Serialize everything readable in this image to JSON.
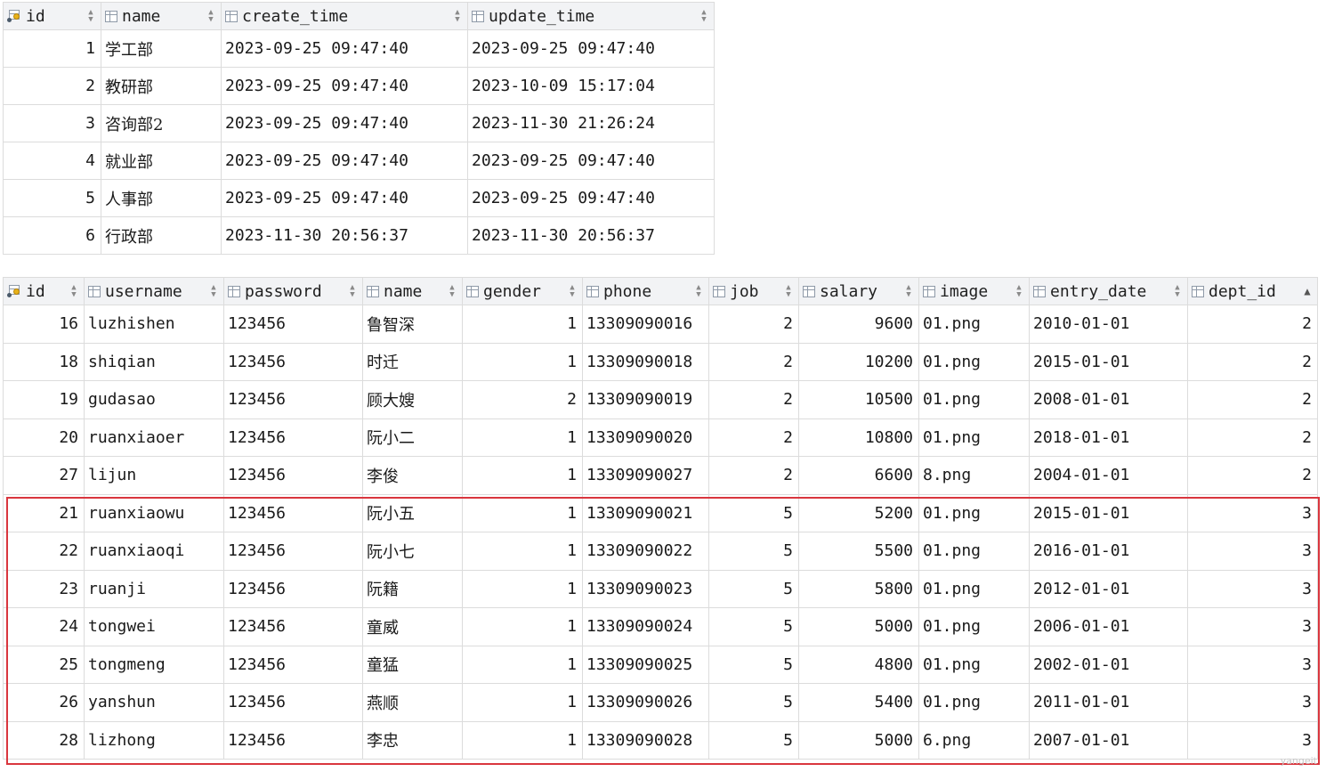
{
  "dept_table": {
    "columns": [
      {
        "key": "id",
        "label": "id",
        "primary": true
      },
      {
        "key": "name",
        "label": "name"
      },
      {
        "key": "create_time",
        "label": "create_time"
      },
      {
        "key": "update_time",
        "label": "update_time"
      }
    ],
    "rows": [
      {
        "id": "1",
        "name": "学工部",
        "create_time": "2023-09-25 09:47:40",
        "update_time": "2023-09-25 09:47:40"
      },
      {
        "id": "2",
        "name": "教研部",
        "create_time": "2023-09-25 09:47:40",
        "update_time": "2023-10-09 15:17:04"
      },
      {
        "id": "3",
        "name": "咨询部2",
        "create_time": "2023-09-25 09:47:40",
        "update_time": "2023-11-30 21:26:24"
      },
      {
        "id": "4",
        "name": "就业部",
        "create_time": "2023-09-25 09:47:40",
        "update_time": "2023-09-25 09:47:40"
      },
      {
        "id": "5",
        "name": "人事部",
        "create_time": "2023-09-25 09:47:40",
        "update_time": "2023-09-25 09:47:40"
      },
      {
        "id": "6",
        "name": "行政部",
        "create_time": "2023-11-30 20:56:37",
        "update_time": "2023-11-30 20:56:37"
      }
    ]
  },
  "emp_table": {
    "columns": [
      {
        "key": "id",
        "label": "id",
        "primary": true
      },
      {
        "key": "username",
        "label": "username"
      },
      {
        "key": "password",
        "label": "password"
      },
      {
        "key": "name",
        "label": "name"
      },
      {
        "key": "gender",
        "label": "gender"
      },
      {
        "key": "phone",
        "label": "phone"
      },
      {
        "key": "job",
        "label": "job"
      },
      {
        "key": "salary",
        "label": "salary"
      },
      {
        "key": "image",
        "label": "image"
      },
      {
        "key": "entry_date",
        "label": "entry_date"
      },
      {
        "key": "dept_id",
        "label": "dept_id",
        "sorted": "asc"
      }
    ],
    "rows": [
      {
        "id": "16",
        "username": "luzhishen",
        "password": "123456",
        "name": "鲁智深",
        "gender": "1",
        "phone": "13309090016",
        "job": "2",
        "salary": "9600",
        "image": "01.png",
        "entry_date": "2010-01-01",
        "dept_id": "2"
      },
      {
        "id": "18",
        "username": "shiqian",
        "password": "123456",
        "name": "时迁",
        "gender": "1",
        "phone": "13309090018",
        "job": "2",
        "salary": "10200",
        "image": "01.png",
        "entry_date": "2015-01-01",
        "dept_id": "2"
      },
      {
        "id": "19",
        "username": "gudasao",
        "password": "123456",
        "name": "顾大嫂",
        "gender": "2",
        "phone": "13309090019",
        "job": "2",
        "salary": "10500",
        "image": "01.png",
        "entry_date": "2008-01-01",
        "dept_id": "2"
      },
      {
        "id": "20",
        "username": "ruanxiaoer",
        "password": "123456",
        "name": "阮小二",
        "gender": "1",
        "phone": "13309090020",
        "job": "2",
        "salary": "10800",
        "image": "01.png",
        "entry_date": "2018-01-01",
        "dept_id": "2"
      },
      {
        "id": "27",
        "username": "lijun",
        "password": "123456",
        "name": "李俊",
        "gender": "1",
        "phone": "13309090027",
        "job": "2",
        "salary": "6600",
        "image": "8.png",
        "entry_date": "2004-01-01",
        "dept_id": "2"
      },
      {
        "id": "21",
        "username": "ruanxiaowu",
        "password": "123456",
        "name": "阮小五",
        "gender": "1",
        "phone": "13309090021",
        "job": "5",
        "salary": "5200",
        "image": "01.png",
        "entry_date": "2015-01-01",
        "dept_id": "3"
      },
      {
        "id": "22",
        "username": "ruanxiaoqi",
        "password": "123456",
        "name": "阮小七",
        "gender": "1",
        "phone": "13309090022",
        "job": "5",
        "salary": "5500",
        "image": "01.png",
        "entry_date": "2016-01-01",
        "dept_id": "3"
      },
      {
        "id": "23",
        "username": "ruanji",
        "password": "123456",
        "name": "阮籍",
        "gender": "1",
        "phone": "13309090023",
        "job": "5",
        "salary": "5800",
        "image": "01.png",
        "entry_date": "2012-01-01",
        "dept_id": "3"
      },
      {
        "id": "24",
        "username": "tongwei",
        "password": "123456",
        "name": "童威",
        "gender": "1",
        "phone": "13309090024",
        "job": "5",
        "salary": "5000",
        "image": "01.png",
        "entry_date": "2006-01-01",
        "dept_id": "3"
      },
      {
        "id": "25",
        "username": "tongmeng",
        "password": "123456",
        "name": "童猛",
        "gender": "1",
        "phone": "13309090025",
        "job": "5",
        "salary": "4800",
        "image": "01.png",
        "entry_date": "2002-01-01",
        "dept_id": "3"
      },
      {
        "id": "26",
        "username": "yanshun",
        "password": "123456",
        "name": "燕顺",
        "gender": "1",
        "phone": "13309090026",
        "job": "5",
        "salary": "5400",
        "image": "01.png",
        "entry_date": "2011-01-01",
        "dept_id": "3"
      },
      {
        "id": "28",
        "username": "lizhong",
        "password": "123456",
        "name": "李忠",
        "gender": "1",
        "phone": "13309090028",
        "job": "5",
        "salary": "5000",
        "image": "6.png",
        "entry_date": "2007-01-01",
        "dept_id": "3"
      }
    ]
  },
  "watermark": "yangeit",
  "colors": {
    "highlight": "#d9363e",
    "header_bg": "#f2f3f5",
    "grid": "#dcdcdc"
  }
}
